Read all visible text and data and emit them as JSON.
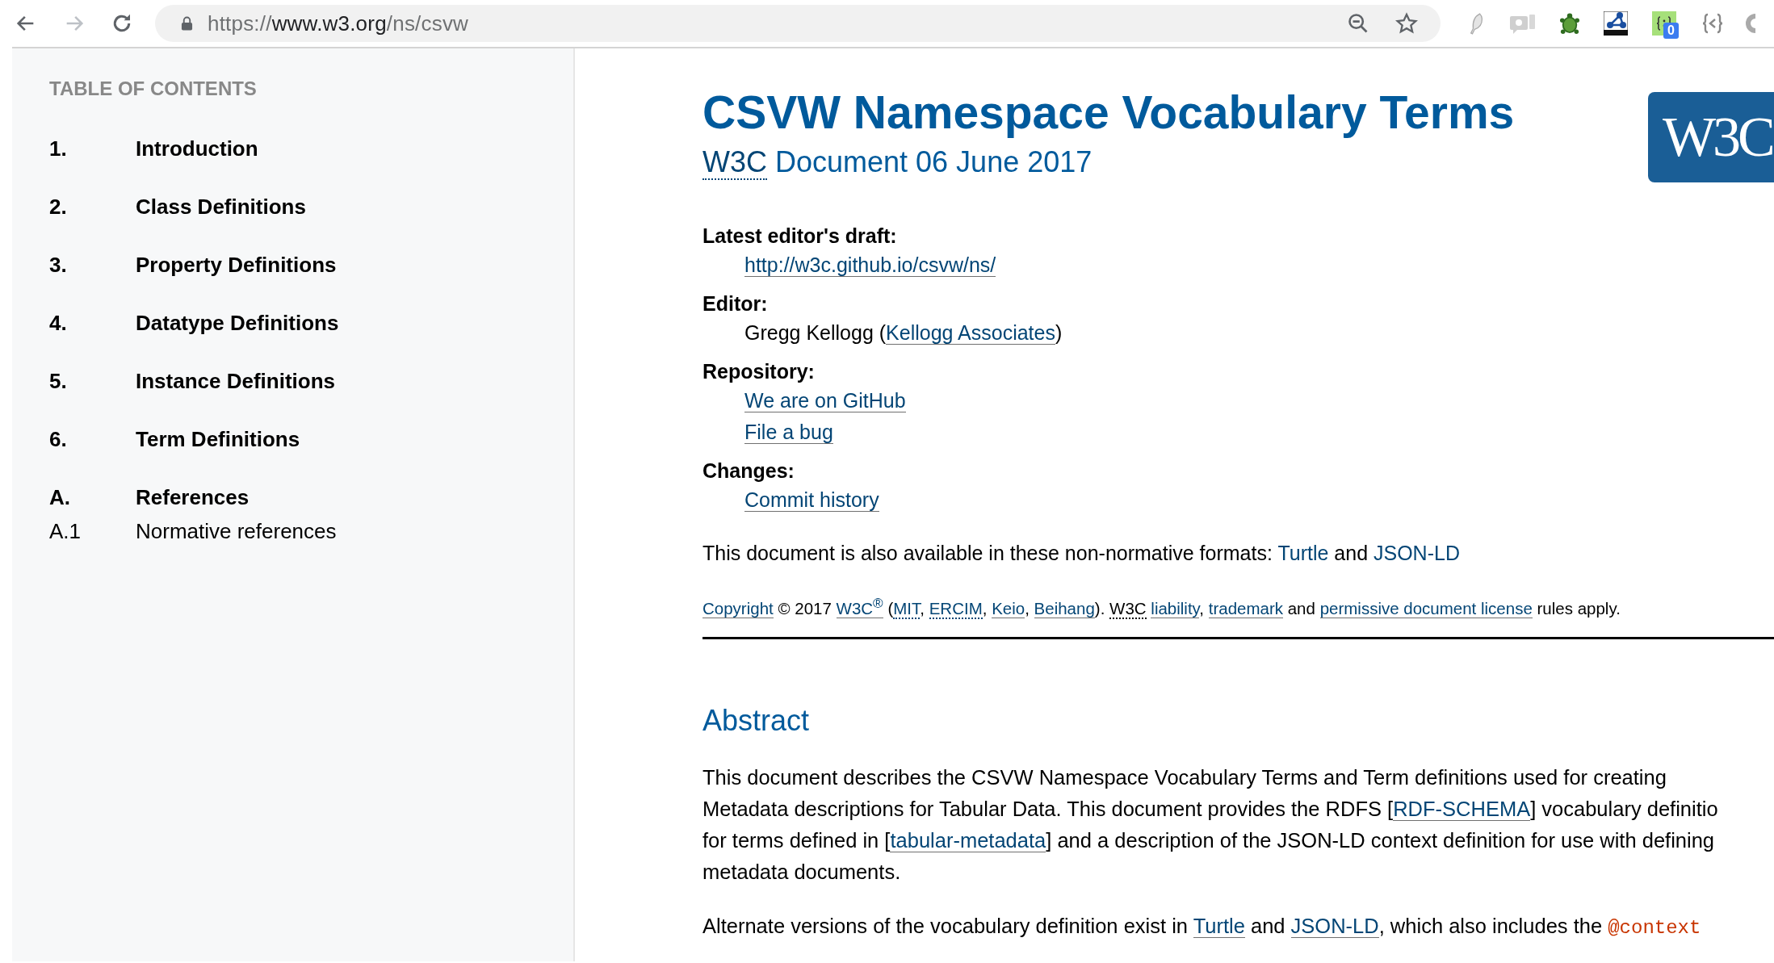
{
  "browser": {
    "url": {
      "scheme": "https://",
      "host": "www.w3.org",
      "path": "/ns/csvw"
    },
    "forward_disabled": true,
    "extension_badge": "0"
  },
  "toc": {
    "title": "TABLE OF CONTENTS",
    "items": [
      {
        "number": "1.",
        "label": "Introduction"
      },
      {
        "number": "2.",
        "label": "Class Definitions"
      },
      {
        "number": "3.",
        "label": "Property Definitions"
      },
      {
        "number": "4.",
        "label": "Datatype Definitions"
      },
      {
        "number": "5.",
        "label": "Instance Definitions"
      },
      {
        "number": "6.",
        "label": "Term Definitions"
      },
      {
        "number": "A.",
        "label": "References",
        "children": [
          {
            "number": "A.1",
            "label": "Normative references"
          }
        ]
      }
    ]
  },
  "header": {
    "title": "CSVW Namespace Vocabulary Terms",
    "subtitle": [
      {
        "kind": "abbr-link",
        "text": "W3C"
      },
      {
        "kind": "text",
        "text": " Document 06 June 2017"
      }
    ],
    "logo": "W3C"
  },
  "details": [
    {
      "term": "Latest editor's draft:",
      "values": [
        [
          {
            "kind": "link",
            "text": "http://w3c.github.io/csvw/ns/"
          }
        ]
      ]
    },
    {
      "term": "Editor:",
      "values": [
        [
          {
            "kind": "text",
            "text": "Gregg Kellogg ("
          },
          {
            "kind": "link",
            "text": "Kellogg Associates"
          },
          {
            "kind": "text",
            "text": ")"
          }
        ]
      ]
    },
    {
      "term": "Repository:",
      "values": [
        [
          {
            "kind": "link",
            "text": "We are on GitHub"
          }
        ],
        [
          {
            "kind": "link",
            "text": "File a bug"
          }
        ]
      ]
    },
    {
      "term": "Changes:",
      "values": [
        [
          {
            "kind": "link",
            "text": "Commit history"
          }
        ]
      ]
    }
  ],
  "formats": [
    {
      "kind": "text",
      "text": "This document is also available in these non-normative formats: "
    },
    {
      "kind": "plain-link",
      "text": "Turtle"
    },
    {
      "kind": "text",
      "text": " and "
    },
    {
      "kind": "plain-link",
      "text": "JSON-LD"
    }
  ],
  "copyright": [
    {
      "kind": "link",
      "text": "Copyright"
    },
    {
      "kind": "text",
      "text": " © 2017 "
    },
    {
      "kind": "link",
      "text": "W3C$^{®}$"
    },
    {
      "kind": "text",
      "text": " ("
    },
    {
      "kind": "abbr-link",
      "text": "MIT"
    },
    {
      "kind": "text",
      "text": ", "
    },
    {
      "kind": "abbr-link",
      "text": "ERCIM"
    },
    {
      "kind": "text",
      "text": ", "
    },
    {
      "kind": "link",
      "text": "Keio"
    },
    {
      "kind": "text",
      "text": ", "
    },
    {
      "kind": "link",
      "text": "Beihang"
    },
    {
      "kind": "text",
      "text": "). "
    },
    {
      "kind": "abbr",
      "text": "W3C"
    },
    {
      "kind": "link",
      "text": "liability"
    },
    {
      "kind": "text",
      "text": ", "
    },
    {
      "kind": "link",
      "text": "trademark"
    },
    {
      "kind": "text",
      "text": " and "
    },
    {
      "kind": "link",
      "text": "permissive document license"
    },
    {
      "kind": "text",
      "text": " rules apply."
    }
  ],
  "abstract": {
    "heading": "Abstract",
    "paragraphs": [
      [
        [
          {
            "kind": "text",
            "text": "This document describes the CSVW Namespace Vocabulary Terms and Term definitions used for creating"
          }
        ],
        [
          {
            "kind": "text",
            "text": "Metadata descriptions for Tabular Data. This document provides the RDFS ["
          },
          {
            "kind": "link",
            "text": "RDF-SCHEMA"
          },
          {
            "kind": "text",
            "text": "] vocabulary definitio"
          }
        ],
        [
          {
            "kind": "text",
            "text": "for terms defined in ["
          },
          {
            "kind": "link",
            "text": "tabular-metadata"
          },
          {
            "kind": "text",
            "text": "] and a description of the JSON-LD context definition for use with defining"
          }
        ],
        [
          {
            "kind": "text",
            "text": "metadata documents."
          }
        ]
      ],
      [
        [
          {
            "kind": "text",
            "text": "Alternate versions of the vocabulary definition exist in "
          },
          {
            "kind": "link",
            "text": "Turtle"
          },
          {
            "kind": "text",
            "text": " and "
          },
          {
            "kind": "link",
            "text": "JSON-LD"
          },
          {
            "kind": "text",
            "text": ", which also includes the "
          },
          {
            "kind": "code",
            "text": "@context"
          }
        ]
      ]
    ]
  }
}
